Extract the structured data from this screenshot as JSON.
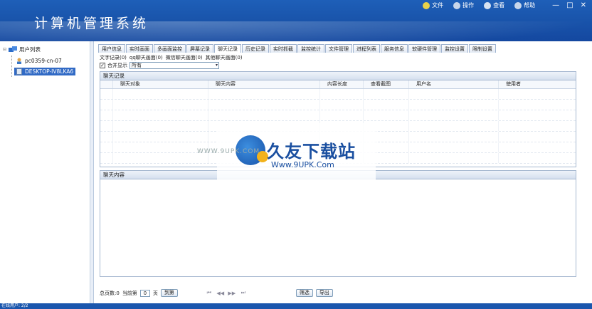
{
  "app": {
    "title": "计算机管理系统"
  },
  "topmenu": [
    {
      "label": "文件",
      "icon": "file-icon",
      "color": "#e8d24a"
    },
    {
      "label": "操作",
      "icon": "wrench-icon",
      "color": "#c8d6ea"
    },
    {
      "label": "查看",
      "icon": "view-icon",
      "color": "#d8e3f1"
    },
    {
      "label": "帮助",
      "icon": "help-icon",
      "color": "#c8d6ea"
    }
  ],
  "window_controls": {
    "minimize": "—",
    "restore": "□",
    "close": "✕"
  },
  "sidebar": {
    "root_label": "用户列表",
    "items": [
      {
        "label": "pc0359-cn-07"
      },
      {
        "label": "DESKTOP-IV8LKA6"
      }
    ]
  },
  "tabs": [
    "用户信息",
    "实时画面",
    "多画面监控",
    "屏幕记录",
    "聊天记录",
    "历史记录",
    "实时抓截",
    "监控统计",
    "文件管理",
    "进程列表",
    "服务信息",
    "软硬件管理",
    "监控设置",
    "限制设置"
  ],
  "active_tab": "聊天记录",
  "subtabs": [
    "文字记录(0)",
    "qq聊天画面(0)",
    "微信聊天画面(0)",
    "其他聊天画面(0)"
  ],
  "filter": {
    "checkbox_label": "合并显示",
    "checked_mark": "✓",
    "select_value": "所有",
    "select_arrow": "▾"
  },
  "chat_record_panel": {
    "title": "聊天记录",
    "columns": [
      "聊天对象",
      "聊天内容",
      "内容长度",
      "查看截图",
      "用户名",
      "使用者"
    ]
  },
  "chat_content_panel": {
    "title": "聊天内容"
  },
  "pager": {
    "total_label": "总页数:0",
    "current_label": "当前第",
    "page_value": "0",
    "page_unit": "页",
    "jump_button": "到第",
    "nav": [
      "⏮",
      "◀◀",
      "▶▶",
      "⏭"
    ],
    "filter_button": "筛选",
    "export_button": "导出"
  },
  "statusbar": {
    "text": "在线用户: 2/2"
  },
  "watermark": {
    "brand": "久友下载站",
    "url": "Www.9UPK.Com",
    "side": "WWW.9UPK.COM"
  }
}
